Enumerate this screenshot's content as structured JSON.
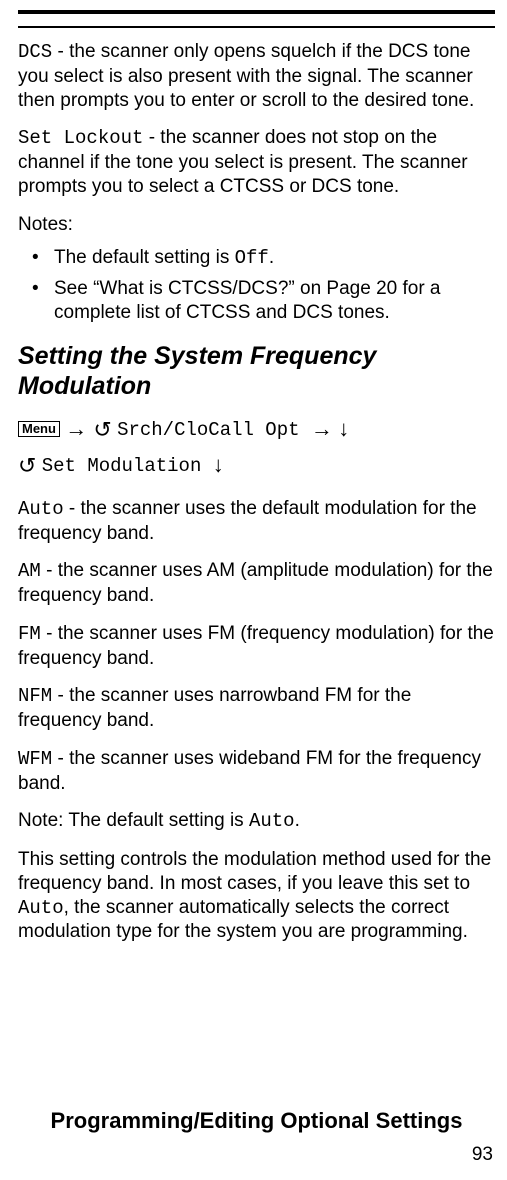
{
  "p1_code": "DCS",
  "p1_text": " - the scanner only opens squelch if the DCS tone you select is also present with the signal. The scanner then prompts you to enter or scroll to the desired tone.",
  "p2_code": "Set Lockout",
  "p2_text": " - the scanner does not stop on the channel if the tone you select is present. The scanner prompts you to select a CTCSS or DCS tone.",
  "notes_label": "Notes:",
  "note1_a": "The default setting is ",
  "note1_code": "Off",
  "note1_b": ".",
  "note2": "See “What is CTCSS/DCS?” on Page 20 for a complete list of CTCSS and DCS tones.",
  "heading": "Setting the System Frequency Modulation",
  "menu_label": "Menu",
  "nav_opt1": " Srch/CloCall Opt ",
  "nav_opt2": " Set Modulation ",
  "auto_code": "Auto",
  "auto_text": " - the scanner uses the default modulation for the frequency band.",
  "am_code": "AM",
  "am_text": " - the scanner uses AM (amplitude modulation) for the frequency band.",
  "fm_code": "FM",
  "fm_text": " - the scanner uses FM (frequency modulation) for the frequency band.",
  "nfm_code": "NFM",
  "nfm_text": " - the scanner uses narrowband FM for the frequency band.",
  "wfm_code": "WFM",
  "wfm_text": " - the scanner uses wideband FM for the frequency band.",
  "note_default_a": "Note: The default setting is ",
  "note_default_code": "Auto",
  "note_default_b": ".",
  "final_a": "This setting controls the modulation method used for the frequency band. In most cases, if you leave this set to ",
  "final_code": "Auto",
  "final_b": ", the scanner automatically selects the correct modulation type for the system you are programming.",
  "footer": "Programming/Editing Optional Settings",
  "pagenum": "93"
}
